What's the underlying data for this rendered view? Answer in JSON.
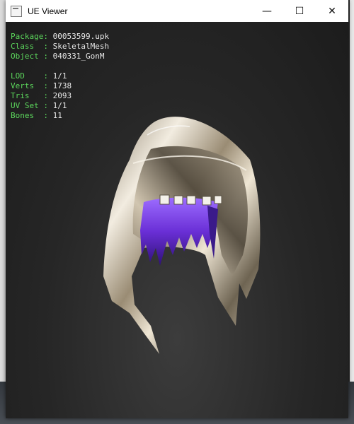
{
  "window": {
    "title": "UE Viewer"
  },
  "controls": {
    "minimize": "—",
    "maximize": "☐",
    "close": "✕"
  },
  "info": {
    "package_label": "Package: ",
    "package_value": "00053599.upk",
    "class_label": "Class  : ",
    "class_value": "SkeletalMesh",
    "object_label": "Object : ",
    "object_value": "040331_GonM",
    "lod_label": "LOD    : ",
    "lod_value": "1/1",
    "verts_label": "Verts  : ",
    "verts_value": "1738",
    "tris_label": "Tris   : ",
    "tris_value": "2093",
    "uvset_label": "UV Set : ",
    "uvset_value": "1/1",
    "bones_label": "Bones  : ",
    "bones_value": "11"
  },
  "colors": {
    "label_green": "#5cd65c",
    "value_white": "#e8e8e8",
    "hood_metal": "#d9cdb8",
    "hair_purple": "#7a3fe0"
  },
  "icons": [
    "app-icon",
    "minimize-icon",
    "maximize-icon",
    "close-icon"
  ]
}
